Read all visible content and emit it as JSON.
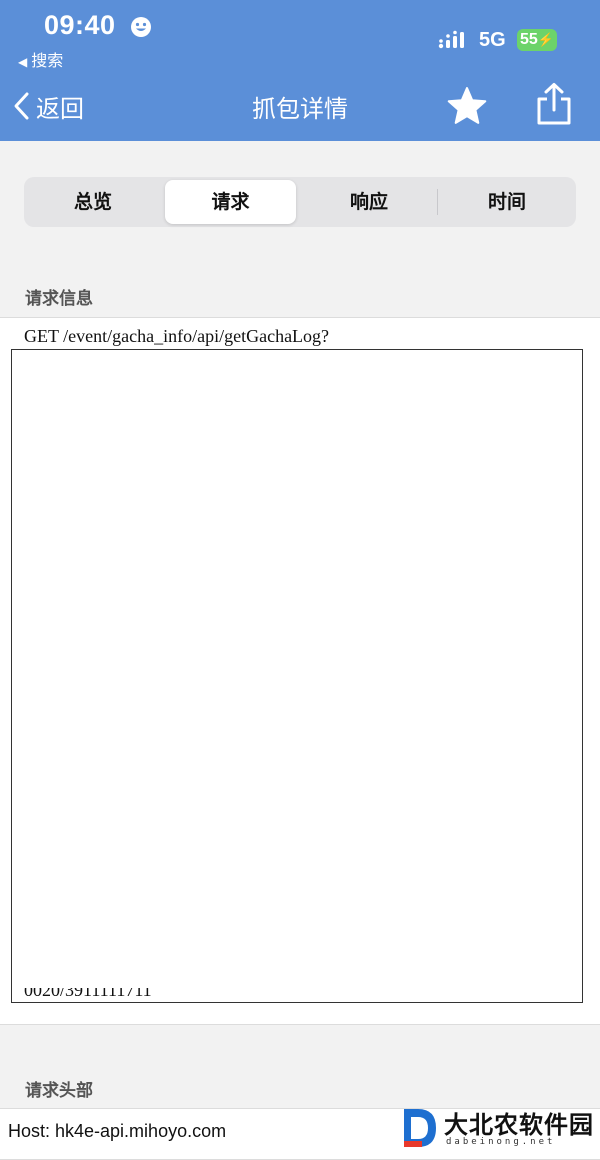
{
  "status_bar": {
    "time": "09:40",
    "back_app": "搜索",
    "network": "5G",
    "battery": "55"
  },
  "nav": {
    "back_label": "返回",
    "title": "抓包详情"
  },
  "tabs": [
    {
      "label": "总览",
      "active": false
    },
    {
      "label": "请求",
      "active": true
    },
    {
      "label": "响应",
      "active": false
    },
    {
      "label": "时间",
      "active": false
    }
  ],
  "request_info": {
    "header": "请求信息",
    "request_line": "GET /event/gacha_info/api/getGachaLog?",
    "cut_line": "0020/3911111711"
  },
  "request_headers": {
    "header": "请求头部",
    "host": "Host: hk4e-api.mihoyo.com"
  },
  "watermark": {
    "name": "大北农软件园",
    "domain": "dabeinong.net"
  },
  "colors": {
    "nav_bar": "#5b8fd8",
    "battery": "#6cd36a"
  }
}
